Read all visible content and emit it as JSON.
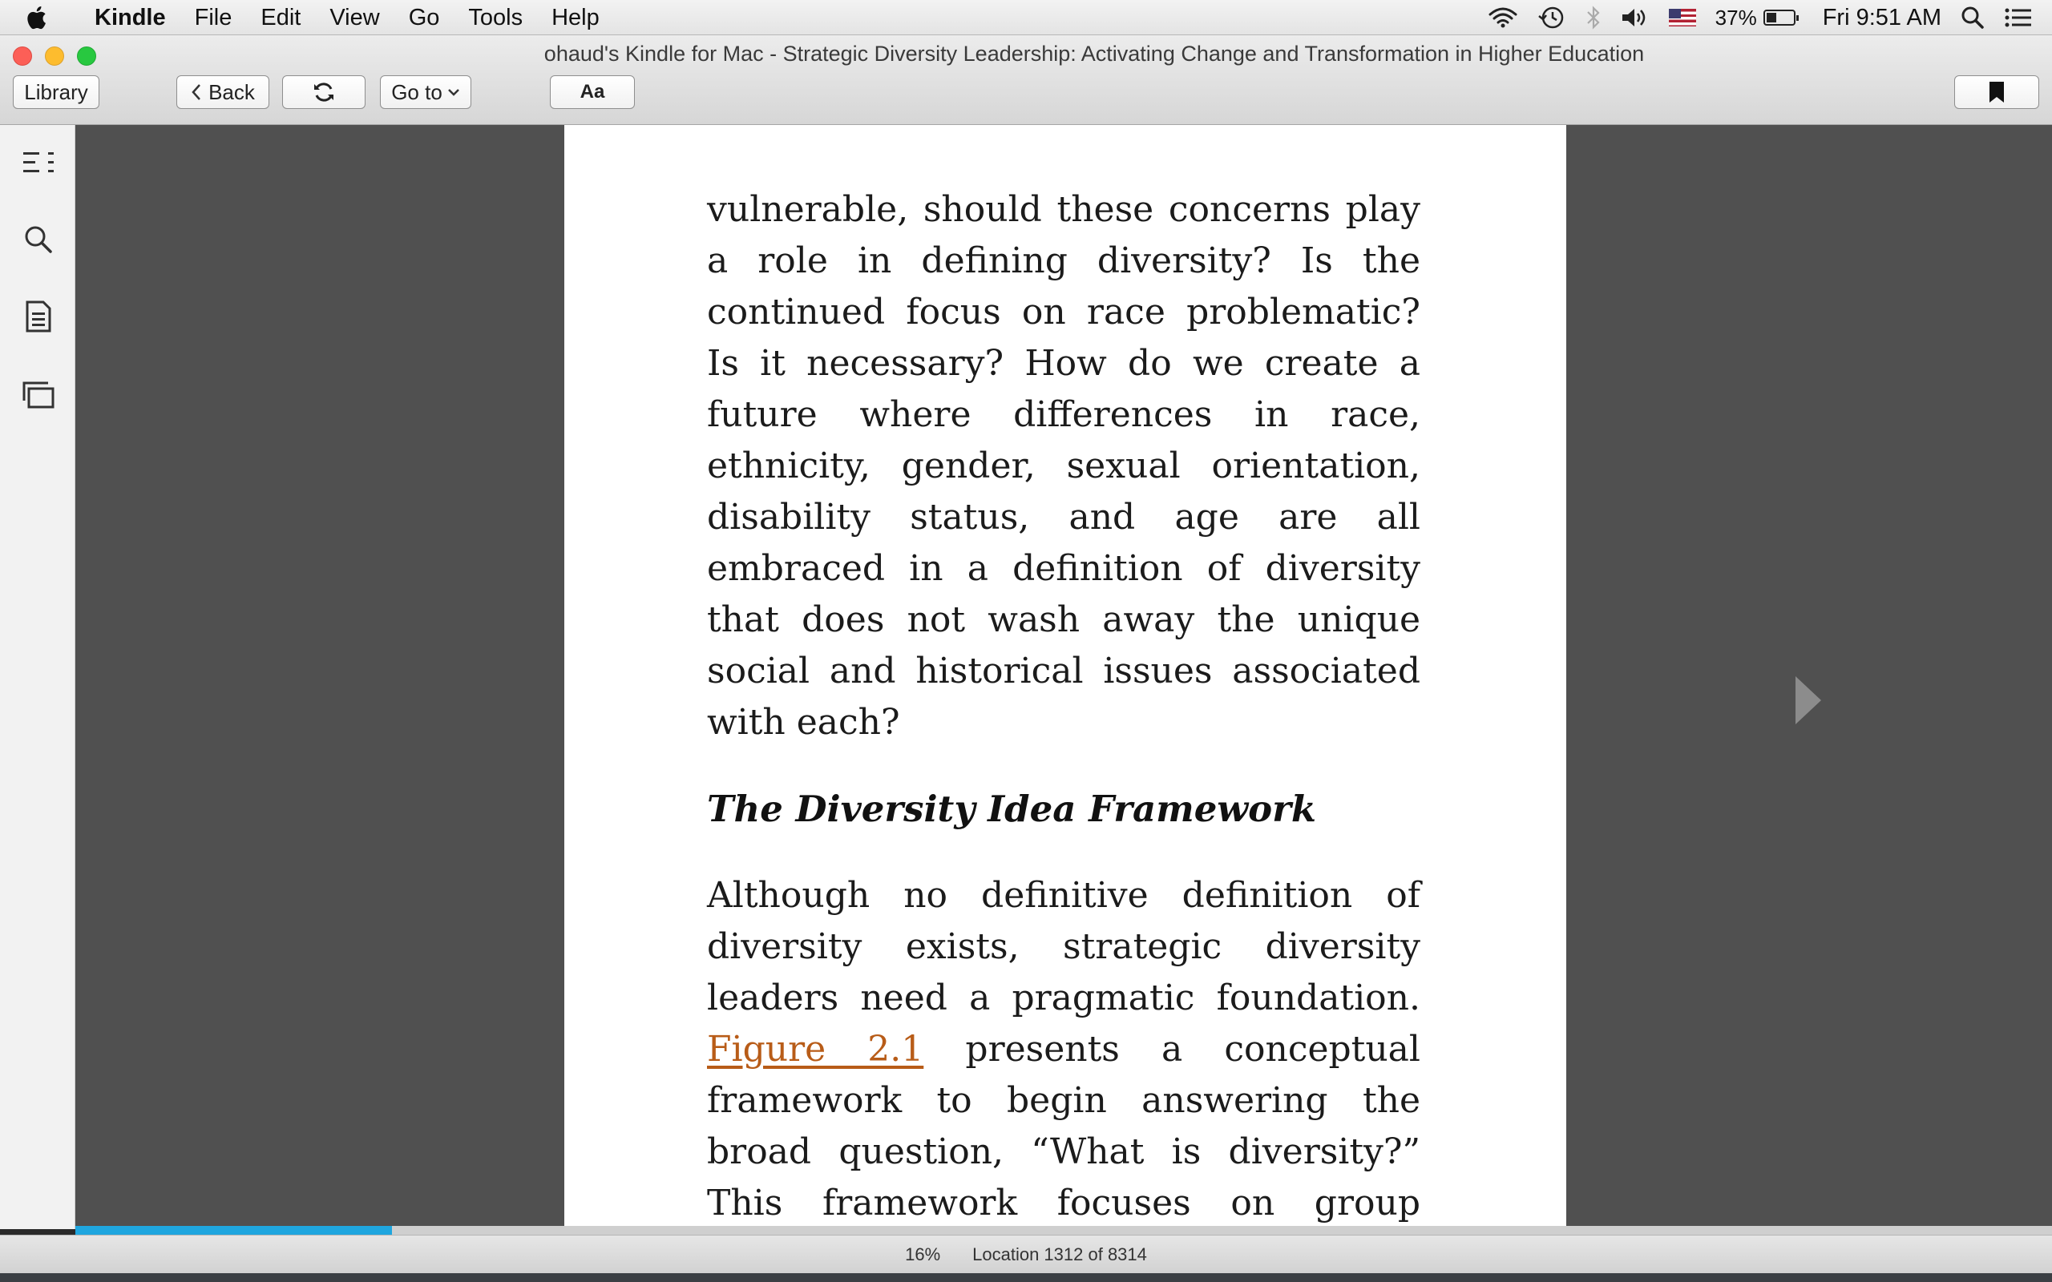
{
  "menubar": {
    "app_name": "Kindle",
    "menus": [
      "File",
      "Edit",
      "View",
      "Go",
      "Tools",
      "Help"
    ],
    "battery_percent": "37%",
    "battery_level": 0.37,
    "clock": "Fri 9:51 AM",
    "status_icons": [
      "wifi-icon",
      "time-machine-icon",
      "bluetooth-icon",
      "volume-icon",
      "us-flag-icon",
      "battery-icon",
      "spotlight-icon",
      "notification-center-icon"
    ]
  },
  "window": {
    "title": "ohaud's Kindle for Mac - Strategic Diversity Leadership: Activating Change and Transformation in Higher Education"
  },
  "toolbar": {
    "library_label": "Library",
    "back_label": "Back",
    "goto_label": "Go to",
    "font_label": "Aa"
  },
  "sidebar": {
    "icons": [
      "table-of-contents-icon",
      "search-icon",
      "notes-icon",
      "flashcards-icon"
    ]
  },
  "book": {
    "para1": "vulnerable, should these concerns play a role in defining diversity? Is the continued focus on race problematic? Is it necessary? How do we create a future where differences in race, ethnicity, gender, sexual orientation, disability status, and age are all embraced in a definition of diversity that does not wash away the unique social and historical issues associated with each?",
    "heading": "The Diversity Idea Framework",
    "para2_before": "Although no definitive definition of diversity exists, strategic diversity leaders need a pragmatic foundation.",
    "para2_link": "Figure 2.1",
    "para2_after": "presents a conceptual framework to begin answering the broad question, “What is diversity?” This framework focuses on group identity and membership,",
    "link_color": "#b85c18"
  },
  "status": {
    "percent": "16%",
    "location": "Location 1312 of 8314",
    "progress": 0.16,
    "accent_color": "#1fa6df"
  }
}
